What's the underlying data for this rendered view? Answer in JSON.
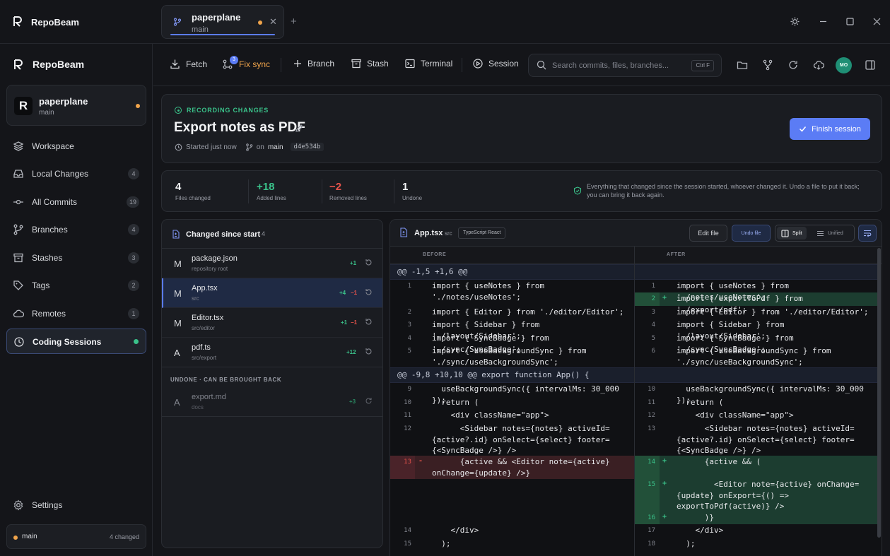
{
  "app": {
    "name": "RepoBeam"
  },
  "tab": {
    "title": "paperplane",
    "branch": "main"
  },
  "sidebar": {
    "brand": "RepoBeam",
    "repo": {
      "name": "paperplane",
      "branch": "main",
      "initial": "R"
    },
    "items": [
      {
        "label": "Workspace",
        "count": null,
        "icon": "layers-icon"
      },
      {
        "label": "Local Changes",
        "count": "4",
        "icon": "inbox-icon"
      },
      {
        "label": "All Commits",
        "count": "19",
        "icon": "commit-icon"
      },
      {
        "label": "Branches",
        "count": "4",
        "icon": "branch-icon"
      },
      {
        "label": "Stashes",
        "count": "3",
        "icon": "archive-icon"
      },
      {
        "label": "Tags",
        "count": "2",
        "icon": "tag-icon"
      },
      {
        "label": "Remotes",
        "count": "1",
        "icon": "cloud-icon"
      },
      {
        "label": "Coding Sessions",
        "count": null,
        "icon": "session-icon",
        "active": true
      }
    ],
    "settings": "Settings",
    "status": {
      "branch": "main",
      "changed": "4 changed"
    }
  },
  "toolbar": {
    "fetch": "Fetch",
    "fix_sync": "Fix sync",
    "fix_sync_badge": "3",
    "branch": "Branch",
    "stash": "Stash",
    "terminal": "Terminal",
    "session": "Session",
    "search_placeholder": "Search commits, files, branches...",
    "search_shortcut": "Ctrl F",
    "user_initials": "MO"
  },
  "session": {
    "status": "RECORDING CHANGES",
    "title": "Export notes as PDF",
    "started": "Started just now",
    "on": "on",
    "branch": "main",
    "hash": "d4e534b",
    "finish": "Finish session"
  },
  "stats": [
    {
      "value": "4",
      "label": "Files changed",
      "color": "#f2f3f5"
    },
    {
      "value": "+18",
      "label": "Added lines",
      "color": "#3ac28a"
    },
    {
      "value": "−2",
      "label": "Removed lines",
      "color": "#e5534b"
    },
    {
      "value": "1",
      "label": "Undone",
      "color": "#f2f3f5"
    }
  ],
  "stats_note": "Everything that changed since the session started, whoever changed it. Undo a file to put it back; you can bring it back again.",
  "files": {
    "title": "Changed since start",
    "count": "4",
    "items": [
      {
        "status": "M",
        "name": "package.json",
        "path": "repository root",
        "add": "+1",
        "del": ""
      },
      {
        "status": "M",
        "name": "App.tsx",
        "path": "src",
        "add": "+4",
        "del": "−1",
        "selected": true
      },
      {
        "status": "M",
        "name": "Editor.tsx",
        "path": "src/editor",
        "add": "+1",
        "del": "−1"
      },
      {
        "status": "A",
        "name": "pdf.ts",
        "path": "src/export",
        "add": "+12",
        "del": ""
      }
    ],
    "undone_label": "UNDONE · CAN BE BROUGHT BACK",
    "undone": [
      {
        "status": "A",
        "name": "export.md",
        "path": "docs",
        "add": "+3"
      }
    ]
  },
  "diff": {
    "file": "App.tsx",
    "dir": "src",
    "lang": "TypeScript React",
    "edit": "Edit file",
    "undo": "Undo file",
    "split": "Split",
    "unified": "Unified",
    "before": "BEFORE",
    "after": "AFTER",
    "hunk1": "@@ -1,5 +1,6 @@",
    "hunk2": "@@ -9,8 +10,10 @@ export function App() {",
    "left_lines": [
      {
        "n": "1",
        "text": "import { useNotes } from './notes/useNotes';"
      },
      {
        "n": "2",
        "text": "import { Editor } from './editor/Editor';"
      },
      {
        "n": "3",
        "text": "import { Sidebar } from './layout/Sidebar';"
      },
      {
        "n": "4",
        "text": "import { SyncBadge } from './sync/SyncBadge';"
      },
      {
        "n": "5",
        "text": "import { useBackgroundSync } from './sync/useBackgroundSync';"
      },
      {
        "n": "9",
        "text": "  useBackgroundSync({ intervalMs: 30_000 });"
      },
      {
        "n": "10",
        "text": "  return ("
      },
      {
        "n": "11",
        "text": "    <div className=\"app\">"
      },
      {
        "n": "12",
        "text": "      <Sidebar notes={notes} activeId={active?.id} onSelect={select} footer={<SyncBadge />} />"
      },
      {
        "n": "13",
        "text": "      {active && <Editor note={active} onChange={update} />}"
      },
      {
        "n": "14",
        "text": "    </div>"
      },
      {
        "n": "15",
        "text": "  );"
      }
    ],
    "right_lines": [
      {
        "n": "1",
        "text": "import { useNotes } from './notes/useNotes';"
      },
      {
        "n": "2",
        "text": "import { exportToPdf } from './export/pdf';"
      },
      {
        "n": "3",
        "text": "import { Editor } from './editor/Editor';"
      },
      {
        "n": "4",
        "text": "import { Sidebar } from './layout/Sidebar';"
      },
      {
        "n": "5",
        "text": "import { SyncBadge } from './sync/SyncBadge';"
      },
      {
        "n": "6",
        "text": "import { useBackgroundSync } from './sync/useBackgroundSync';"
      },
      {
        "n": "10",
        "text": "  useBackgroundSync({ intervalMs: 30_000 });"
      },
      {
        "n": "11",
        "text": "  return ("
      },
      {
        "n": "12",
        "text": "    <div className=\"app\">"
      },
      {
        "n": "13",
        "text": "      <Sidebar notes={notes} activeId={active?.id} onSelect={select} footer={<SyncBadge />} />"
      },
      {
        "n": "14",
        "text": "      {active && ("
      },
      {
        "n": "15",
        "text": "        <Editor note={active} onChange={update} onExport={() => exportToPdf(active)} />"
      },
      {
        "n": "16",
        "text": "      )}"
      },
      {
        "n": "17",
        "text": "    </div>"
      },
      {
        "n": "18",
        "text": "  );"
      }
    ],
    "minus": "-",
    "plus": "+"
  },
  "colors": {
    "accent": "#5b7cf5",
    "added": "#3ac28a",
    "removed": "#e5534b",
    "pending": "#f0a44b"
  }
}
